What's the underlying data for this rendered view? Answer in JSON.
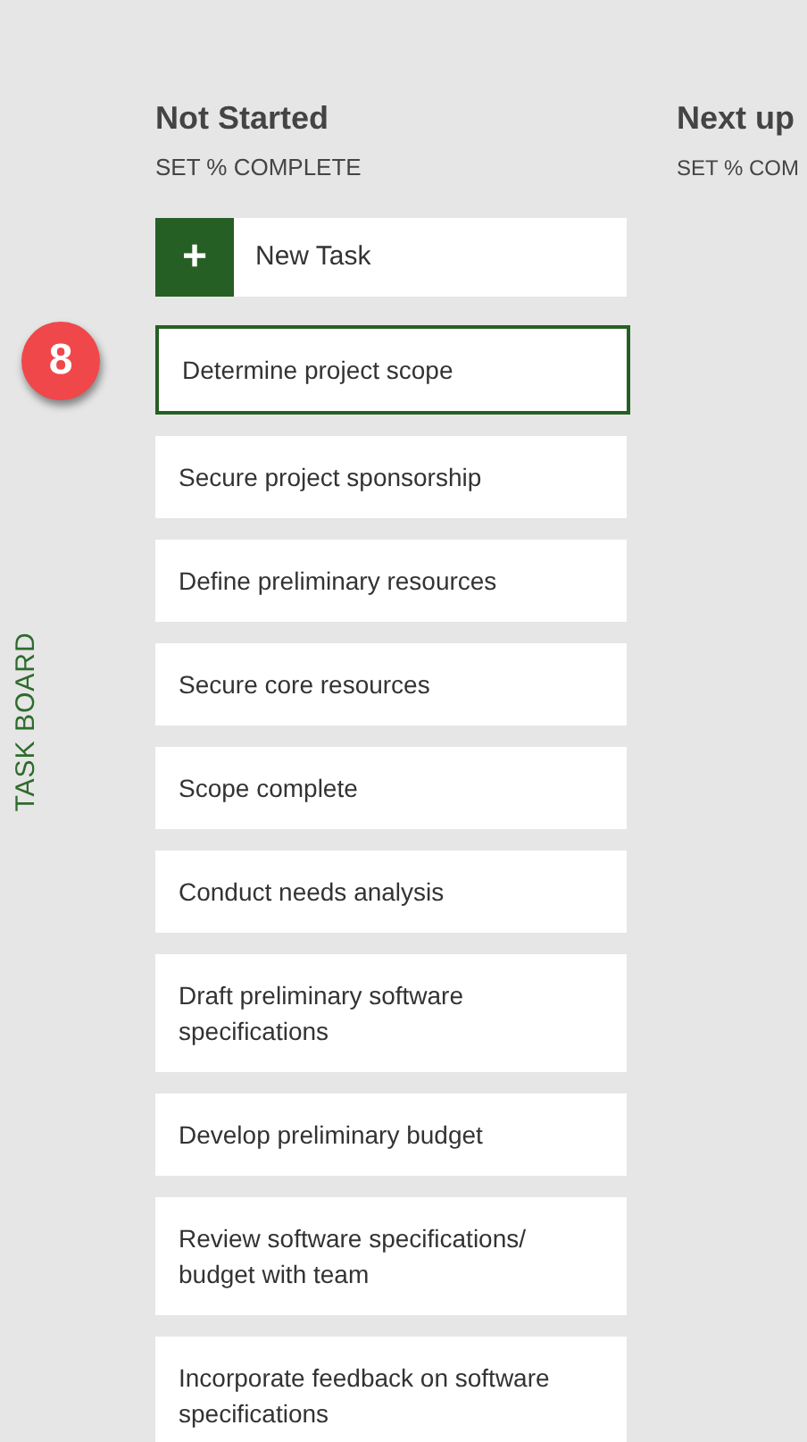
{
  "sidebar": {
    "label": "TASK BOARD"
  },
  "callout": {
    "label": "8"
  },
  "columns": [
    {
      "title": "Not Started",
      "action": "SET % COMPLETE",
      "new_task": {
        "icon": "+",
        "label": "New Task"
      },
      "tasks": [
        {
          "label": "Determine project scope",
          "selected": true
        },
        {
          "label": "Secure project sponsorship",
          "selected": false
        },
        {
          "label": "Define preliminary resources",
          "selected": false
        },
        {
          "label": "Secure core resources",
          "selected": false
        },
        {
          "label": "Scope complete",
          "selected": false
        },
        {
          "label": "Conduct needs analysis",
          "selected": false
        },
        {
          "label": "Draft preliminary software specifications",
          "selected": false
        },
        {
          "label": "Develop preliminary budget",
          "selected": false
        },
        {
          "label": "Review software specifications/ budget with team",
          "selected": false
        },
        {
          "label": "Incorporate feedback on software specifications",
          "selected": false
        }
      ]
    },
    {
      "title": "Next up",
      "action": "SET % COM"
    }
  ]
}
